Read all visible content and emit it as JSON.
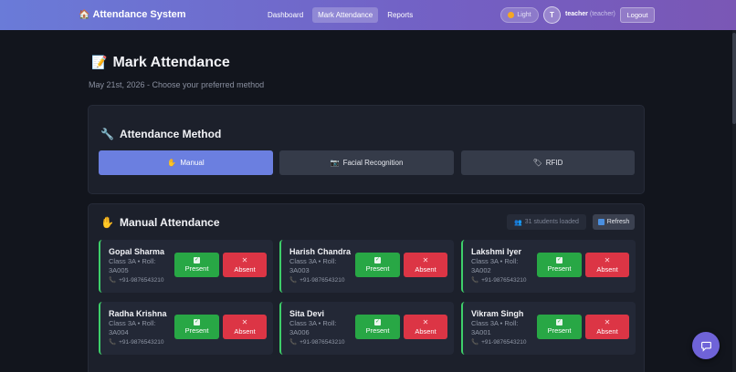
{
  "header": {
    "brand_icon": "house-icon",
    "brand": "Attendance System",
    "nav": [
      {
        "label": "Dashboard",
        "active": false
      },
      {
        "label": "Mark Attendance",
        "active": true
      },
      {
        "label": "Reports",
        "active": false
      }
    ],
    "theme_toggle": "Light",
    "avatar_initial": "T",
    "username": "teacher",
    "role": "(teacher)",
    "logout": "Logout"
  },
  "page": {
    "title_icon": "memo-icon",
    "title": "Mark Attendance",
    "subtitle": "May 21st, 2026 - Choose your preferred method"
  },
  "method": {
    "title": "Attendance Method",
    "buttons": [
      {
        "icon": "✋",
        "label": "Manual",
        "active": true
      },
      {
        "icon": "📷",
        "label": "Facial Recognition",
        "active": false
      },
      {
        "icon": "🏷",
        "label": "RFID",
        "active": false
      }
    ]
  },
  "manual": {
    "title": "Manual Attendance",
    "loaded": "31 students loaded",
    "refresh": "Refresh",
    "present_label": "Present",
    "absent_label": "Absent",
    "students": [
      {
        "name": "Gopal Sharma",
        "meta": "Class 3A • Roll: 3A005",
        "phone": "+91-9876543210"
      },
      {
        "name": "Harish Chandra",
        "meta": "Class 3A • Roll: 3A003",
        "phone": "+91-9876543210"
      },
      {
        "name": "Lakshmi Iyer",
        "meta": "Class 3A • Roll: 3A002",
        "phone": "+91-9876543210"
      },
      {
        "name": "Radha Krishna",
        "meta": "Class 3A • Roll: 3A004",
        "phone": "+91-9876543210"
      },
      {
        "name": "Sita Devi",
        "meta": "Class 3A • Roll: 3A006",
        "phone": "+91-9876543210"
      },
      {
        "name": "Vikram Singh",
        "meta": "Class 3A • Roll: 3A001",
        "phone": "+91-9876543210"
      }
    ]
  },
  "colors": {
    "accent": "#6b7fe0",
    "present": "#28a745",
    "absent": "#dc3545",
    "card_border": "#3ecf6a"
  }
}
